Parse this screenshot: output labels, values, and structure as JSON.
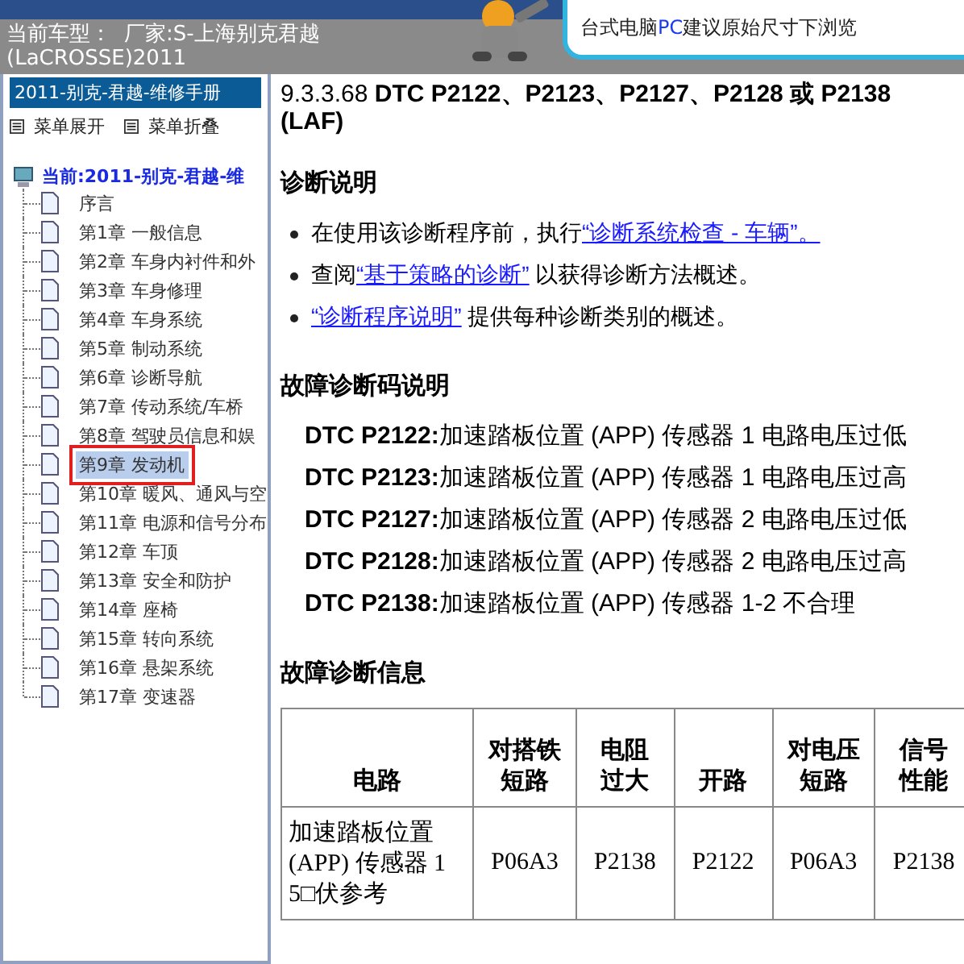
{
  "banner": {
    "vehicle_label": "当前车型：",
    "vehicle_value": "厂家:S-上海别克君越",
    "vehicle_value_line2": "(LaCROSSE)2011",
    "notice": [
      {
        "text": "台式电脑",
        "kind": "plain"
      },
      {
        "text": "PC",
        "kind": "highlight"
      },
      {
        "text": "建议原始尺寸下浏览",
        "kind": "plain"
      }
    ]
  },
  "sidebar": {
    "title": "2011-别克-君越-维修手册",
    "menu_buttons": [
      {
        "label": "菜单展开"
      },
      {
        "label": "菜单折叠"
      }
    ],
    "root": {
      "label": "当前:2011-别克-君越-维",
      "children": [
        {
          "label": "序言",
          "selected": false
        },
        {
          "label": "第1章 一般信息",
          "selected": false
        },
        {
          "label": "第2章 车身内衬件和外",
          "selected": false
        },
        {
          "label": "第3章 车身修理",
          "selected": false
        },
        {
          "label": "第4章 车身系统",
          "selected": false
        },
        {
          "label": "第5章 制动系统",
          "selected": false
        },
        {
          "label": "第6章 诊断导航",
          "selected": false
        },
        {
          "label": "第7章 传动系统/车桥",
          "selected": false
        },
        {
          "label": "第8章 驾驶员信息和娱",
          "selected": false
        },
        {
          "label": "第9章 发动机",
          "selected": true
        },
        {
          "label": "第10章 暖风、通风与空",
          "selected": false
        },
        {
          "label": "第11章 电源和信号分布",
          "selected": false
        },
        {
          "label": "第12章 车顶",
          "selected": false
        },
        {
          "label": "第13章 安全和防护",
          "selected": false
        },
        {
          "label": "第14章 座椅",
          "selected": false
        },
        {
          "label": "第15章 转向系统",
          "selected": false
        },
        {
          "label": "第16章 悬架系统",
          "selected": false
        },
        {
          "label": "第17章 变速器",
          "selected": false
        }
      ]
    }
  },
  "content": {
    "title": "9.3.3.68 **DTC P2122、P2123、P2127、P2128 或 P2138 (LAF)**",
    "sections": [
      {
        "kind": "bullets",
        "heading": "诊断说明",
        "items": [
          [
            {
              "kind": "text",
              "text": "在使用该诊断程序前，执行"
            },
            {
              "kind": "link",
              "text": "“诊断系统检查 - 车辆”。"
            }
          ],
          [
            {
              "kind": "text",
              "text": "查阅"
            },
            {
              "kind": "link",
              "text": "“基于策略的诊断”"
            },
            {
              "kind": "text",
              "text": " 以获得诊断方法概述。"
            }
          ],
          [
            {
              "kind": "link",
              "text": "“诊断程序说明”"
            },
            {
              "kind": "text",
              "text": " 提供每种诊断类别的概述。"
            }
          ]
        ]
      },
      {
        "kind": "codes",
        "heading": "故障诊断码说明",
        "items": [
          "**DTC P2122:**加速踏板位置 (APP) 传感器 1 电路电压过低",
          "**DTC P2123:**加速踏板位置 (APP) 传感器 1 电路电压过高",
          "**DTC P2127:**加速踏板位置 (APP) 传感器 2 电路电压过低",
          "**DTC P2128:**加速踏板位置 (APP) 传感器 2 电路电压过高",
          "**DTC P2138:**加速踏板位置 (APP) 传感器 1-2 不合理"
        ]
      },
      {
        "kind": "table",
        "heading": "故障诊断信息",
        "columns": [
          "电路",
          "对搭铁短路",
          "电阻过大",
          "开路",
          "对电压短路",
          "信号性能"
        ],
        "rows": [
          [
            "加速踏板位置 (APP) 传感器 1 5□伏参考",
            "P06A3",
            "P2138",
            "P2122",
            "P06A3",
            "P2138"
          ]
        ]
      }
    ]
  }
}
